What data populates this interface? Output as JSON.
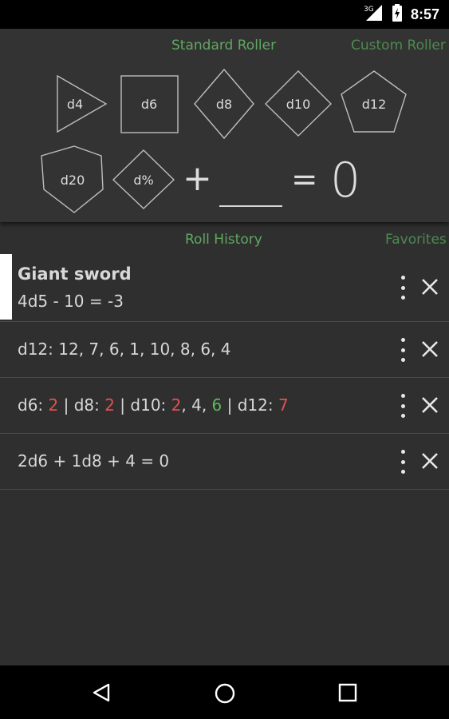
{
  "status_bar": {
    "network_label": "3G",
    "time": "8:57",
    "icons": [
      "signal-icon",
      "battery-icon"
    ]
  },
  "roller": {
    "tabs": [
      {
        "label": "Standard Roller",
        "active": true
      },
      {
        "label": "Custom Roller",
        "active": false
      }
    ],
    "dice": [
      "d4",
      "d6",
      "d8",
      "d10",
      "d12",
      "d20",
      "d%"
    ],
    "plus": "+",
    "equals": "=",
    "modifier_value": "",
    "result": "0"
  },
  "history_tabs": [
    {
      "label": "Roll History",
      "active": true
    },
    {
      "label": "Favorites",
      "active": false
    }
  ],
  "history": [
    {
      "title": "Giant sword",
      "text": "4d5 - 10 = -3",
      "highlighted": true
    },
    {
      "text": "d12: 12, 7, 6, 1, 10, 8, 6, 4"
    },
    {
      "segments": [
        {
          "t": "d6: ",
          "c": "normal"
        },
        {
          "t": "2",
          "c": "low"
        },
        {
          "t": " | d8: ",
          "c": "normal"
        },
        {
          "t": "2",
          "c": "low"
        },
        {
          "t": " | d10: ",
          "c": "normal"
        },
        {
          "t": "2",
          "c": "low"
        },
        {
          "t": ", 4, ",
          "c": "normal"
        },
        {
          "t": "6",
          "c": "high"
        },
        {
          "t": " | d12: ",
          "c": "normal"
        },
        {
          "t": "7",
          "c": "low"
        }
      ]
    },
    {
      "text": "2d6 + 1d8 + 4 = 0"
    }
  ],
  "colors": {
    "accent_green": "#5fa860",
    "low_roll": "#e05252",
    "high_roll": "#5cb85c",
    "background": "#2f2f2f"
  },
  "nav_bar": {
    "buttons": [
      "back-icon",
      "home-icon",
      "recents-icon"
    ]
  }
}
